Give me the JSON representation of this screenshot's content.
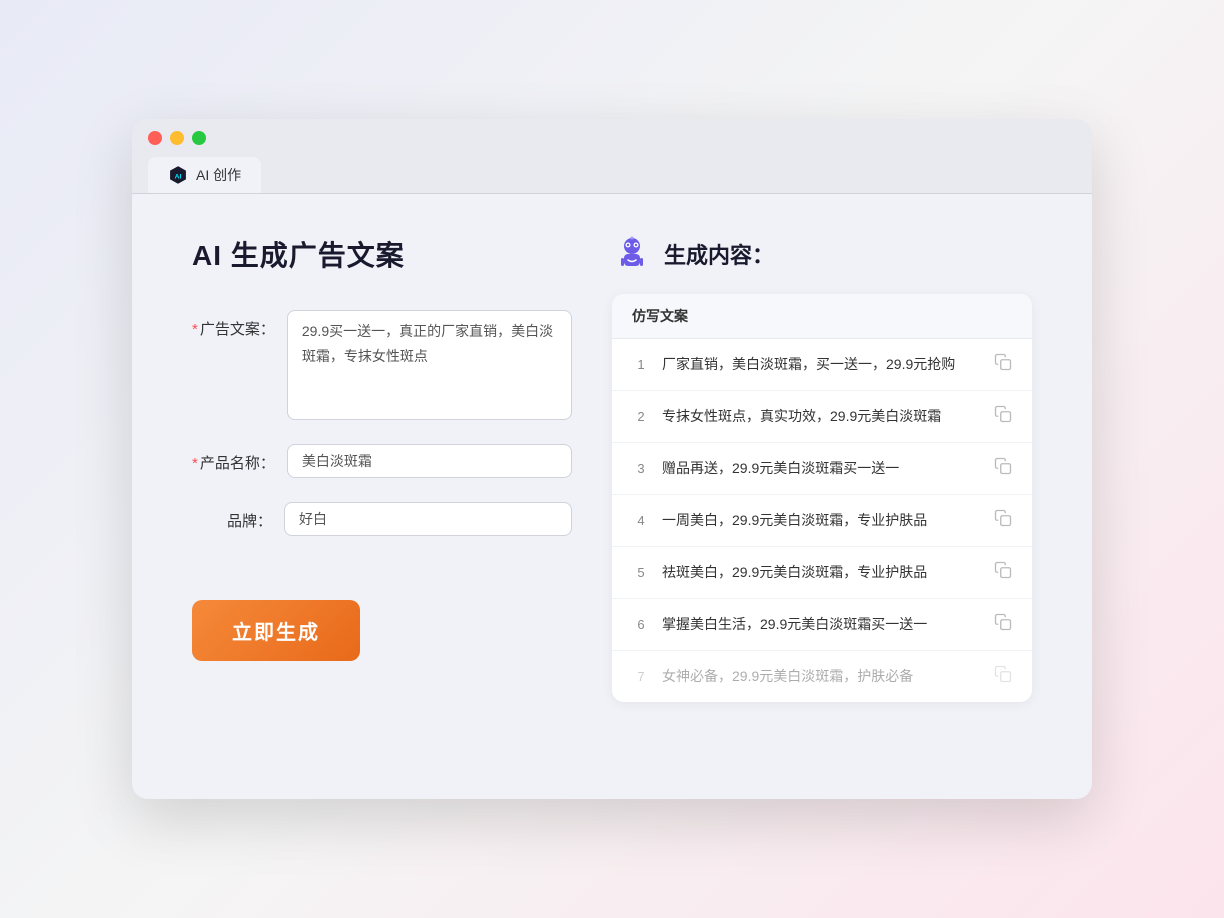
{
  "browser": {
    "tab_label": "AI 创作"
  },
  "page": {
    "title": "AI 生成广告文案",
    "generate_button": "立即生成"
  },
  "form": {
    "ad_copy_label": "广告文案：",
    "ad_copy_required": true,
    "ad_copy_value": "29.9买一送一，真正的厂家直销，美白淡斑霜，专抹女性斑点",
    "product_name_label": "产品名称：",
    "product_name_required": true,
    "product_name_value": "美白淡斑霜",
    "brand_label": "品牌：",
    "brand_required": false,
    "brand_value": "好白"
  },
  "results": {
    "header": "生成内容：",
    "column_label": "仿写文案",
    "items": [
      {
        "id": 1,
        "text": "厂家直销，美白淡斑霜，买一送一，29.9元抢购",
        "faded": false
      },
      {
        "id": 2,
        "text": "专抹女性斑点，真实功效，29.9元美白淡斑霜",
        "faded": false
      },
      {
        "id": 3,
        "text": "赠品再送，29.9元美白淡斑霜买一送一",
        "faded": false
      },
      {
        "id": 4,
        "text": "一周美白，29.9元美白淡斑霜，专业护肤品",
        "faded": false
      },
      {
        "id": 5,
        "text": "祛斑美白，29.9元美白淡斑霜，专业护肤品",
        "faded": false
      },
      {
        "id": 6,
        "text": "掌握美白生活，29.9元美白淡斑霜买一送一",
        "faded": false
      },
      {
        "id": 7,
        "text": "女神必备，29.9元美白淡斑霜，护肤必备",
        "faded": true
      }
    ]
  }
}
